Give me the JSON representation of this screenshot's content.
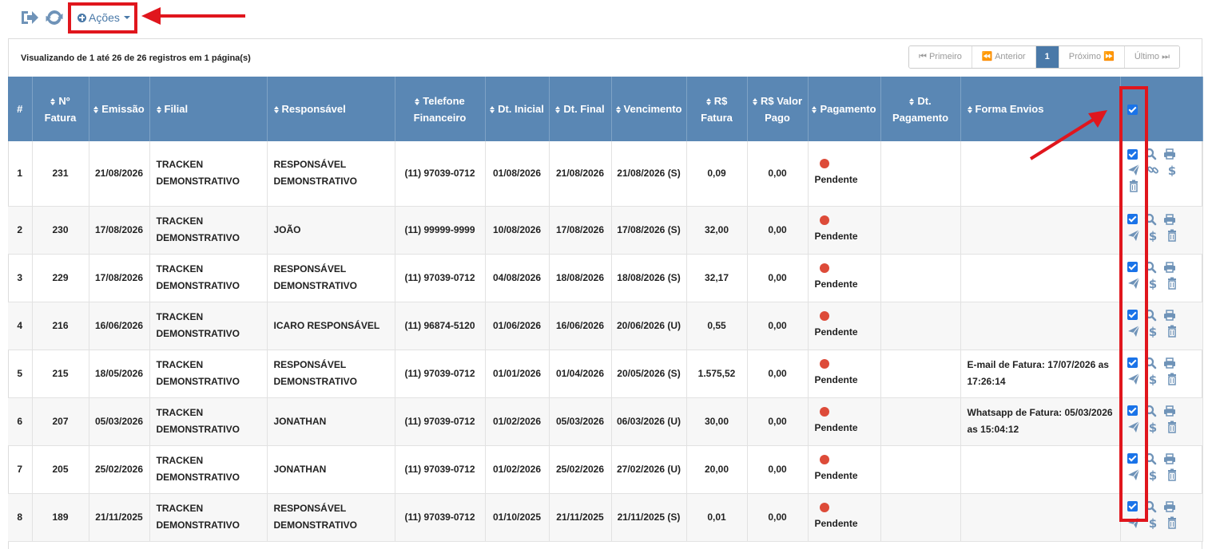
{
  "toolbar": {
    "exit_icon": "sign-out-icon",
    "refresh_icon": "refresh-icon",
    "actions_label": "Ações"
  },
  "info": {
    "text": "Visualizando de 1 até 26 de 26 registros em 1 página(s)"
  },
  "pagination": {
    "first": "Primeiro",
    "prev": "Anterior",
    "current": "1",
    "next": "Próximo",
    "last": "Último"
  },
  "columns": [
    {
      "key": "num",
      "label": "#",
      "sortable": false
    },
    {
      "key": "fatura",
      "label": "Nº Fatura",
      "sortable": true
    },
    {
      "key": "emissao",
      "label": "Emissão",
      "sortable": true
    },
    {
      "key": "filial",
      "label": "Filial",
      "sortable": true
    },
    {
      "key": "responsavel",
      "label": "Responsável",
      "sortable": true
    },
    {
      "key": "telefone",
      "label": "Telefone Financeiro",
      "sortable": true
    },
    {
      "key": "dt_inicial",
      "label": "Dt. Inicial",
      "sortable": true
    },
    {
      "key": "dt_final",
      "label": "Dt. Final",
      "sortable": true
    },
    {
      "key": "vencimento",
      "label": "Vencimento",
      "sortable": true
    },
    {
      "key": "valor",
      "label": "R$ Fatura",
      "sortable": true
    },
    {
      "key": "valor_pago",
      "label": "R$ Valor Pago",
      "sortable": true
    },
    {
      "key": "pagamento",
      "label": "Pagamento",
      "sortable": true
    },
    {
      "key": "dt_pagamento",
      "label": "Dt. Pagamento",
      "sortable": true
    },
    {
      "key": "forma_envios",
      "label": "Forma Envios",
      "sortable": true
    }
  ],
  "rows": [
    {
      "num": "1",
      "fatura": "231",
      "emissao": "21/08/2026",
      "filial": "TRACKEN DEMONSTRATIVO",
      "responsavel": "RESPONSÁVEL DEMONSTRATIVO",
      "telefone": "(11) 97039-0712",
      "dt_inicial": "01/08/2026",
      "dt_final": "21/08/2026",
      "vencimento": "21/08/2026 (S)",
      "valor": "0,09",
      "valor_pago": "0,00",
      "pagamento": "Pendente",
      "dt_pagamento": "",
      "forma_envios": "",
      "extra_link": true
    },
    {
      "num": "2",
      "fatura": "230",
      "emissao": "17/08/2026",
      "filial": "TRACKEN DEMONSTRATIVO",
      "responsavel": "JOÃO",
      "telefone": "(11) 99999-9999",
      "dt_inicial": "10/08/2026",
      "dt_final": "17/08/2026",
      "vencimento": "17/08/2026 (S)",
      "valor": "32,00",
      "valor_pago": "0,00",
      "pagamento": "Pendente",
      "dt_pagamento": "",
      "forma_envios": "",
      "extra_link": false
    },
    {
      "num": "3",
      "fatura": "229",
      "emissao": "17/08/2026",
      "filial": "TRACKEN DEMONSTRATIVO",
      "responsavel": "RESPONSÁVEL DEMONSTRATIVO",
      "telefone": "(11) 97039-0712",
      "dt_inicial": "04/08/2026",
      "dt_final": "18/08/2026",
      "vencimento": "18/08/2026 (S)",
      "valor": "32,17",
      "valor_pago": "0,00",
      "pagamento": "Pendente",
      "dt_pagamento": "",
      "forma_envios": "",
      "extra_link": false
    },
    {
      "num": "4",
      "fatura": "216",
      "emissao": "16/06/2026",
      "filial": "TRACKEN DEMONSTRATIVO",
      "responsavel": "ICARO RESPONSÁVEL",
      "telefone": "(11) 96874-5120",
      "dt_inicial": "01/06/2026",
      "dt_final": "16/06/2026",
      "vencimento": "20/06/2026 (U)",
      "valor": "0,55",
      "valor_pago": "0,00",
      "pagamento": "Pendente",
      "dt_pagamento": "",
      "forma_envios": "",
      "extra_link": false
    },
    {
      "num": "5",
      "fatura": "215",
      "emissao": "18/05/2026",
      "filial": "TRACKEN DEMONSTRATIVO",
      "responsavel": "RESPONSÁVEL DEMONSTRATIVO",
      "telefone": "(11) 97039-0712",
      "dt_inicial": "01/01/2026",
      "dt_final": "01/04/2026",
      "vencimento": "20/05/2026 (S)",
      "valor": "1.575,52",
      "valor_pago": "0,00",
      "pagamento": "Pendente",
      "dt_pagamento": "",
      "forma_envios": "E-mail de Fatura: 17/07/2026 as 17:26:14",
      "extra_link": false
    },
    {
      "num": "6",
      "fatura": "207",
      "emissao": "05/03/2026",
      "filial": "TRACKEN DEMONSTRATIVO",
      "responsavel": "JONATHAN",
      "telefone": "(11) 97039-0712",
      "dt_inicial": "01/02/2026",
      "dt_final": "05/03/2026",
      "vencimento": "06/03/2026 (U)",
      "valor": "30,00",
      "valor_pago": "0,00",
      "pagamento": "Pendente",
      "dt_pagamento": "",
      "forma_envios": "Whatsapp de Fatura: 05/03/2026 as 15:04:12",
      "extra_link": false
    },
    {
      "num": "7",
      "fatura": "205",
      "emissao": "25/02/2026",
      "filial": "TRACKEN DEMONSTRATIVO",
      "responsavel": "JONATHAN",
      "telefone": "(11) 97039-0712",
      "dt_inicial": "01/02/2026",
      "dt_final": "25/02/2026",
      "vencimento": "27/02/2026 (U)",
      "valor": "20,00",
      "valor_pago": "0,00",
      "pagamento": "Pendente",
      "dt_pagamento": "",
      "forma_envios": "",
      "extra_link": false
    },
    {
      "num": "8",
      "fatura": "189",
      "emissao": "21/11/2025",
      "filial": "TRACKEN DEMONSTRATIVO",
      "responsavel": "RESPONSÁVEL DEMONSTRATIVO",
      "telefone": "(11) 97039-0712",
      "dt_inicial": "01/10/2025",
      "dt_final": "21/11/2025",
      "vencimento": "21/11/2025 (S)",
      "valor": "0,01",
      "valor_pago": "0,00",
      "pagamento": "Pendente",
      "dt_pagamento": "",
      "forma_envios": "",
      "extra_link": false
    }
  ],
  "row_actions": [
    "checkbox",
    "search-icon",
    "print-icon",
    "send-icon",
    "link-icon",
    "dollar-icon",
    "trash-icon"
  ],
  "colors": {
    "header_bg": "#5a87b4",
    "accent": "#4a79a8",
    "icon": "#6f93b8",
    "pending_dot": "#dd4b39",
    "highlight": "#e0161d",
    "checkbox": "#1a73e8"
  }
}
